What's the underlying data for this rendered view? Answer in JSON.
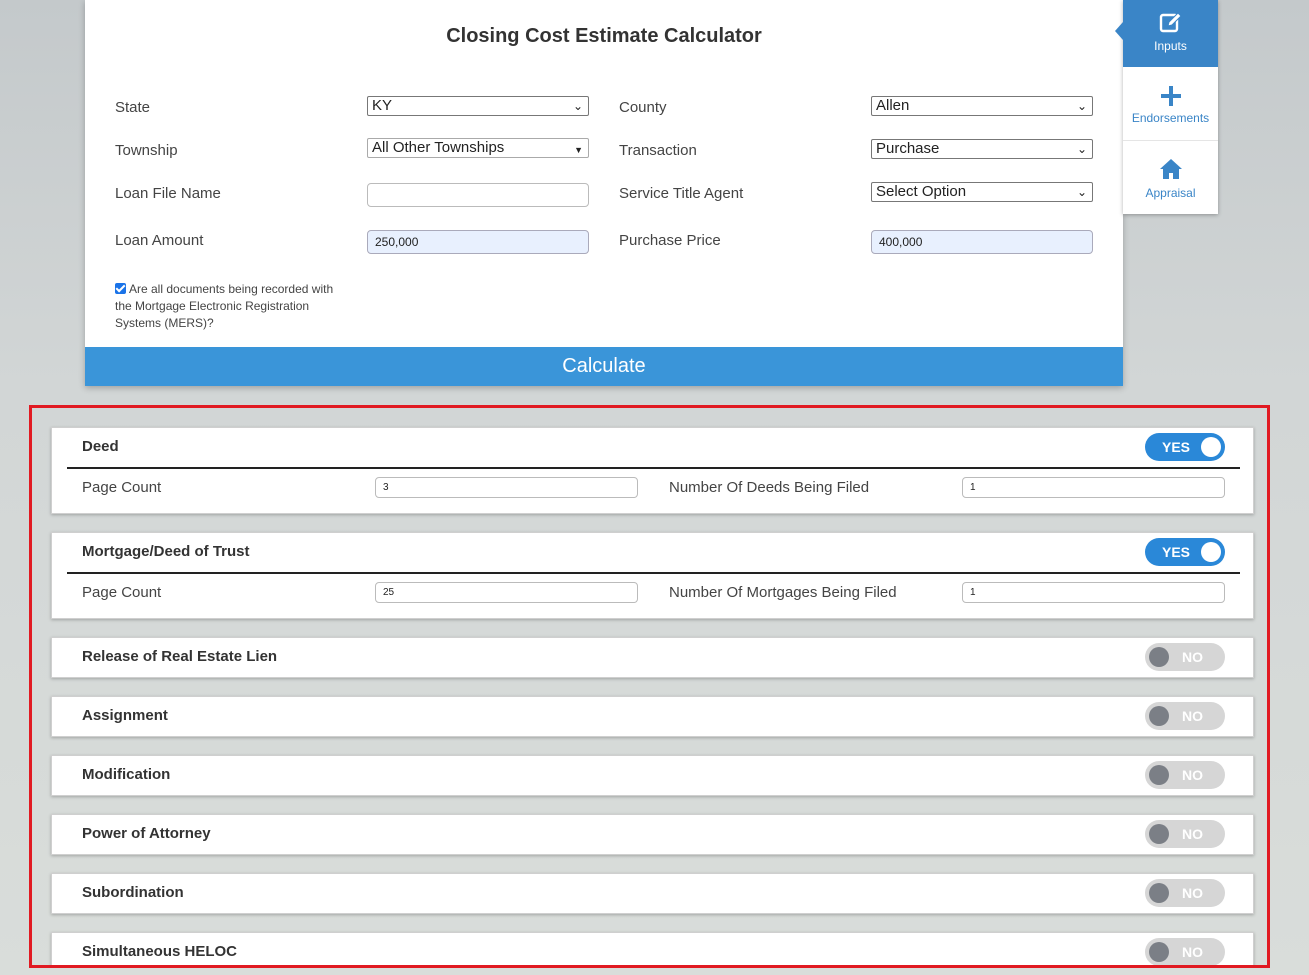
{
  "calculator": {
    "title": "Closing Cost Estimate Calculator",
    "state": {
      "label": "State",
      "value": "KY"
    },
    "county": {
      "label": "County",
      "value": "Allen"
    },
    "township": {
      "label": "Township",
      "value": "All Other Townships"
    },
    "transaction": {
      "label": "Transaction",
      "value": "Purchase"
    },
    "loan_file_name": {
      "label": "Loan File Name",
      "value": ""
    },
    "service_title_agent": {
      "label": "Service Title Agent",
      "value": "Select Option"
    },
    "loan_amount": {
      "label": "Loan Amount",
      "value": "250,000"
    },
    "purchase_price": {
      "label": "Purchase Price",
      "value": "400,000"
    },
    "mers_question": "Are all documents being recorded with the Mortgage Electronic Registration Systems (MERS)?",
    "mers_checked": true,
    "calculate_label": "Calculate"
  },
  "sidenav": {
    "items": [
      {
        "label": "Inputs",
        "icon": "edit-icon",
        "active": true
      },
      {
        "label": "Endorsements",
        "icon": "plus-icon",
        "active": false
      },
      {
        "label": "Appraisal",
        "icon": "home-icon",
        "active": false
      }
    ]
  },
  "documents": {
    "deed": {
      "title": "Deed",
      "toggle": "YES",
      "page_count_label": "Page Count",
      "page_count": "3",
      "number_label": "Number Of Deeds Being Filed",
      "number": "1"
    },
    "mortgage": {
      "title": "Mortgage/Deed of Trust",
      "toggle": "YES",
      "page_count_label": "Page Count",
      "page_count": "25",
      "number_label": "Number Of Mortgages Being Filed",
      "number": "1"
    },
    "release": {
      "title": "Release of Real Estate Lien",
      "toggle": "NO"
    },
    "assignment": {
      "title": "Assignment",
      "toggle": "NO"
    },
    "modification": {
      "title": "Modification",
      "toggle": "NO"
    },
    "power_of_attorney": {
      "title": "Power of Attorney",
      "toggle": "NO"
    },
    "subordination": {
      "title": "Subordination",
      "toggle": "NO"
    },
    "simultaneous_heloc": {
      "title": "Simultaneous HELOC",
      "toggle": "NO"
    }
  },
  "colors": {
    "accent": "#3a95d9",
    "toggle_on": "#2a88d8",
    "toggle_off": "#d6d6d6",
    "highlight_border": "#e11a22"
  }
}
